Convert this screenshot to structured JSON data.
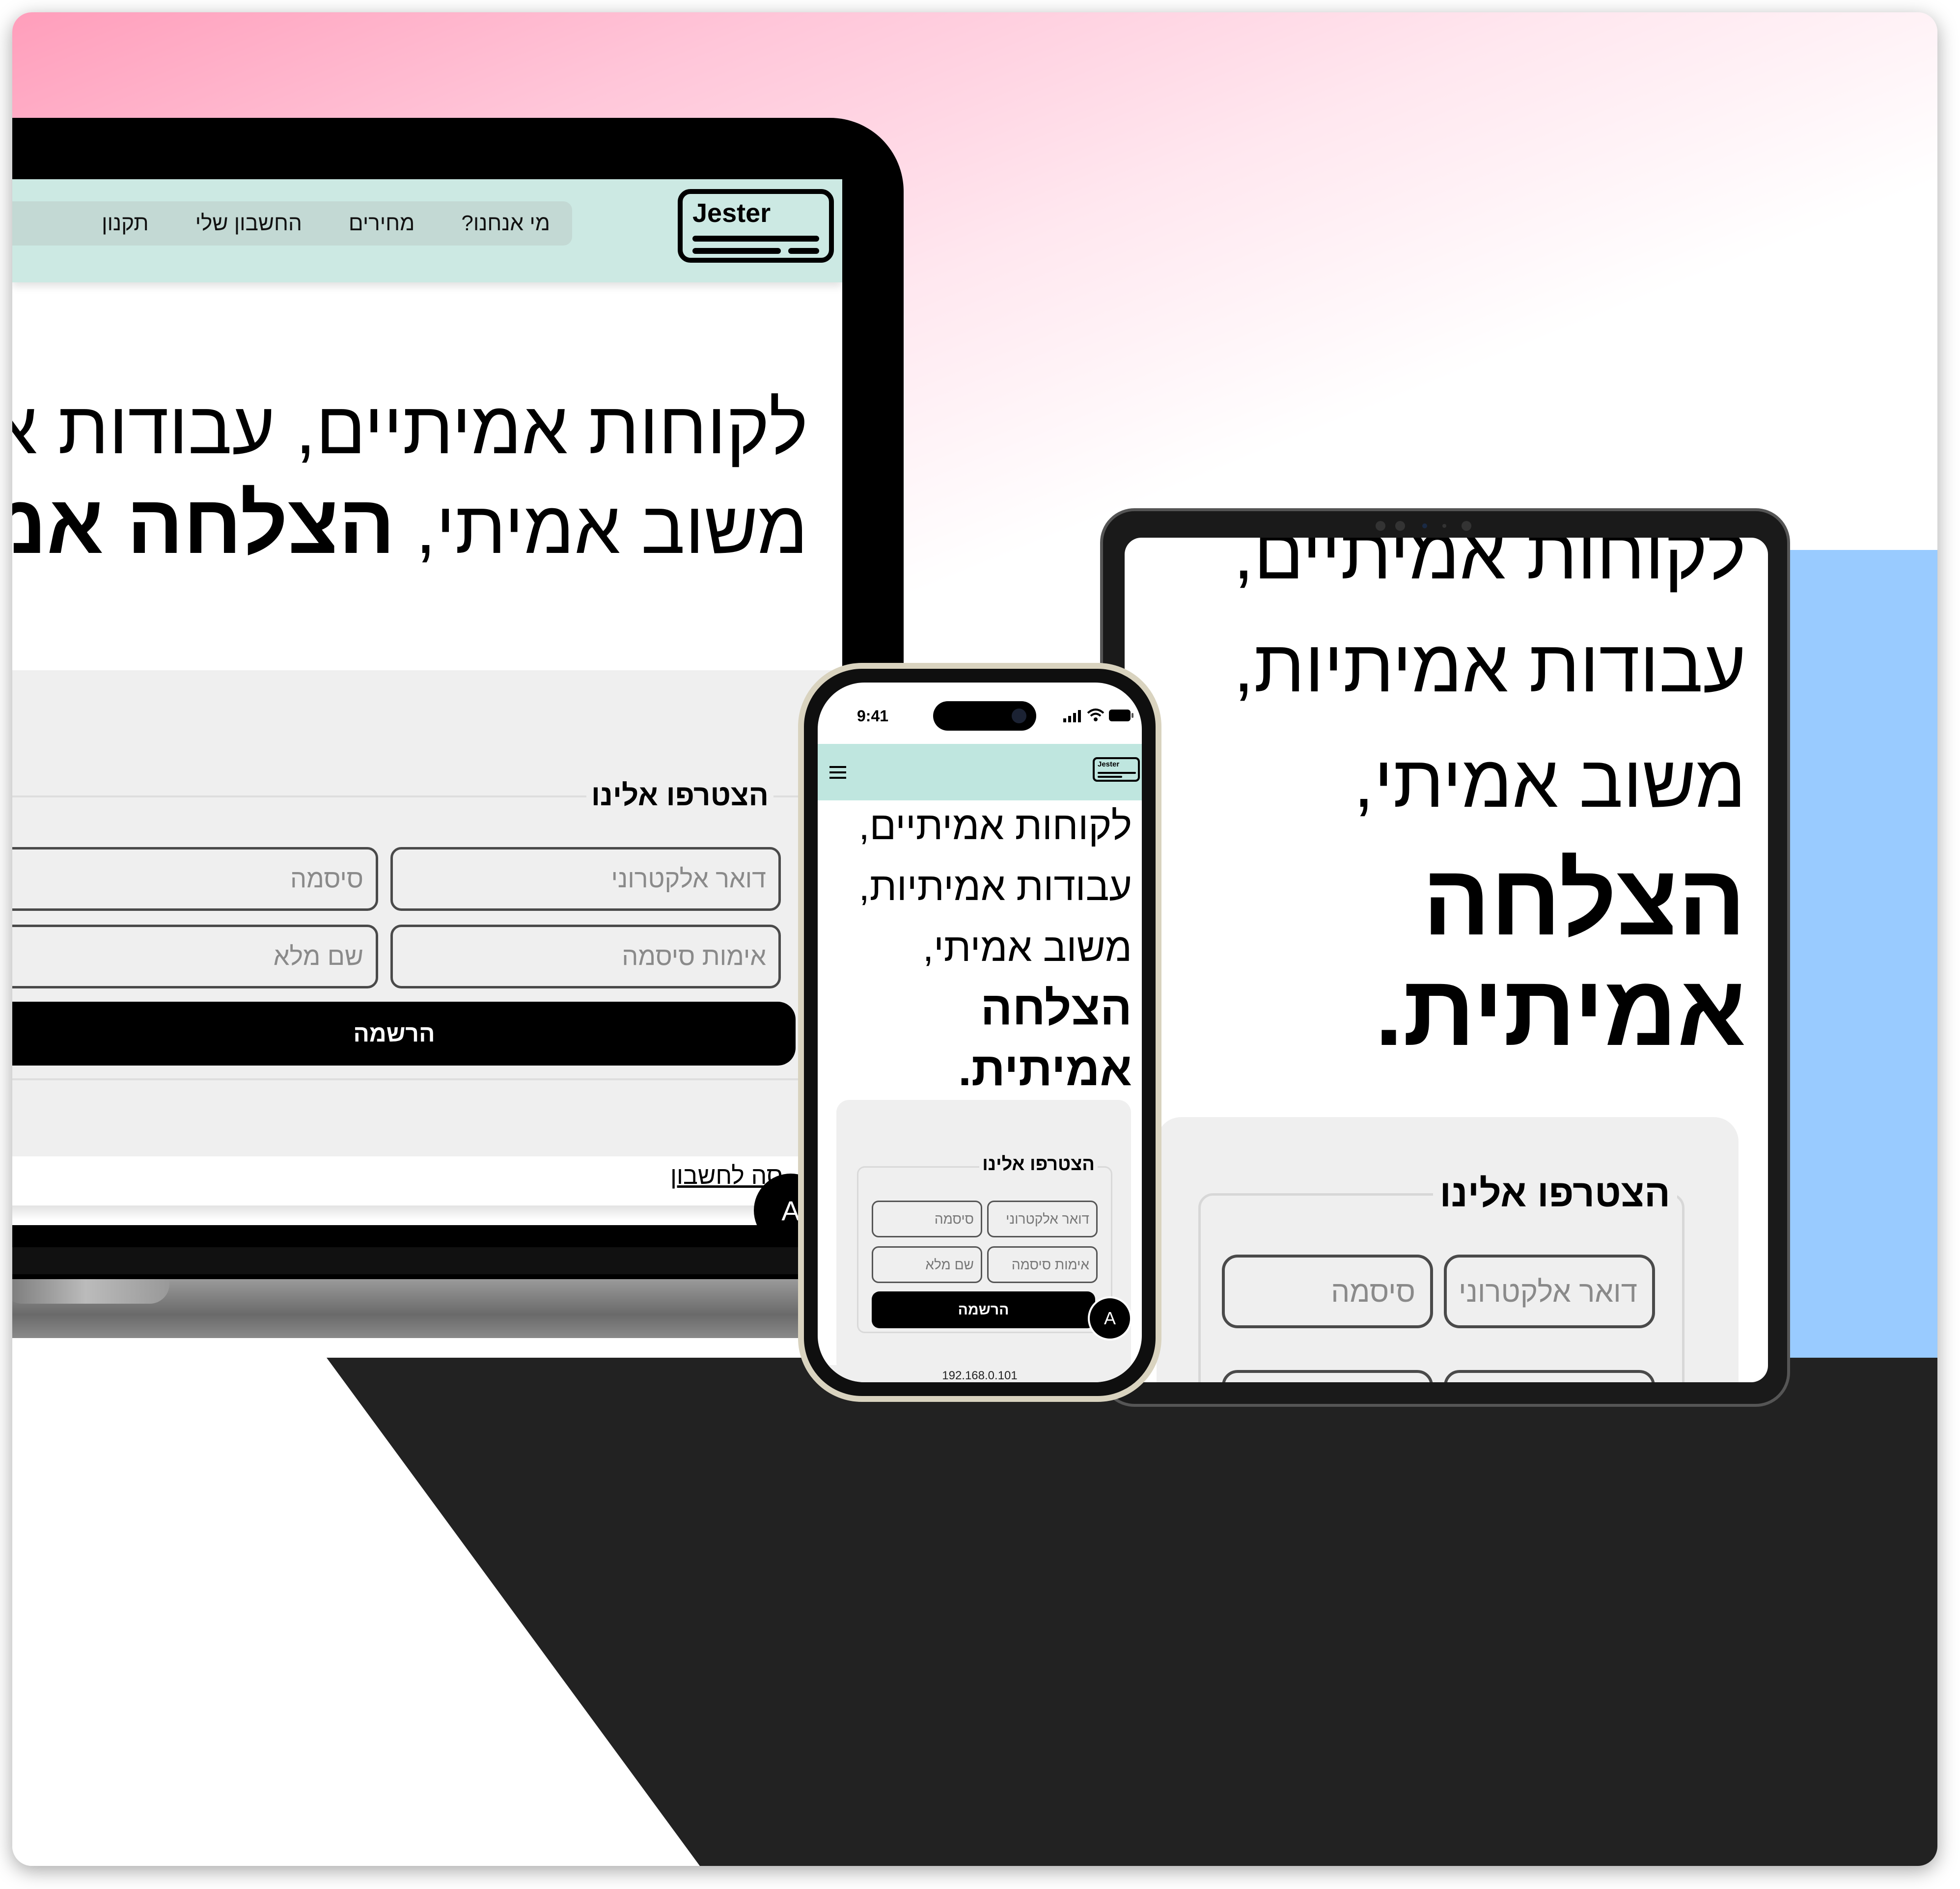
{
  "brand": {
    "name": "Jester"
  },
  "nav": {
    "items": [
      "מי אנחנו?",
      "מחירים",
      "החשבון שלי",
      "תקנון"
    ]
  },
  "hero": {
    "laptop_line1": "לקוחות אמיתיים, עבודות אמי",
    "laptop_line2_regular": "משוב אמיתי,",
    "laptop_line2_bold": "הצלחה אמי",
    "tablet_lines": [
      "לקוחות אמיתיים,",
      "עבודות אמיתיות,",
      "משוב אמיתי,"
    ],
    "tablet_bold_lines": [
      "הצלחה",
      "אמיתית."
    ],
    "phone_lines": [
      "לקוחות אמיתיים,",
      "עבודות אמיתיות,",
      "משוב אמיתי,"
    ],
    "phone_bold_lines": [
      "הצלחה",
      "אמיתית."
    ]
  },
  "signup": {
    "title": "הצטרפו אלינו",
    "email_placeholder": "דואר אלקטרוני",
    "password_placeholder": "סיסמה",
    "confirm_password_placeholder": "אימות סיסמה",
    "full_name_placeholder": "שם מלא",
    "submit_label": "הרשמה",
    "login_link": "סה לחשבון"
  },
  "avatar": {
    "initial": "A"
  },
  "phone_status": {
    "time": "9:41",
    "url": "192.168.0.101"
  },
  "colors": {
    "header_mint": "#cce9e3",
    "accent_blue": "#99cbff",
    "background_pink": "#ff9ebb",
    "dark_floor": "#222222"
  },
  "icons": [
    "menu-icon",
    "signal-icon",
    "wifi-icon",
    "battery-icon"
  ]
}
